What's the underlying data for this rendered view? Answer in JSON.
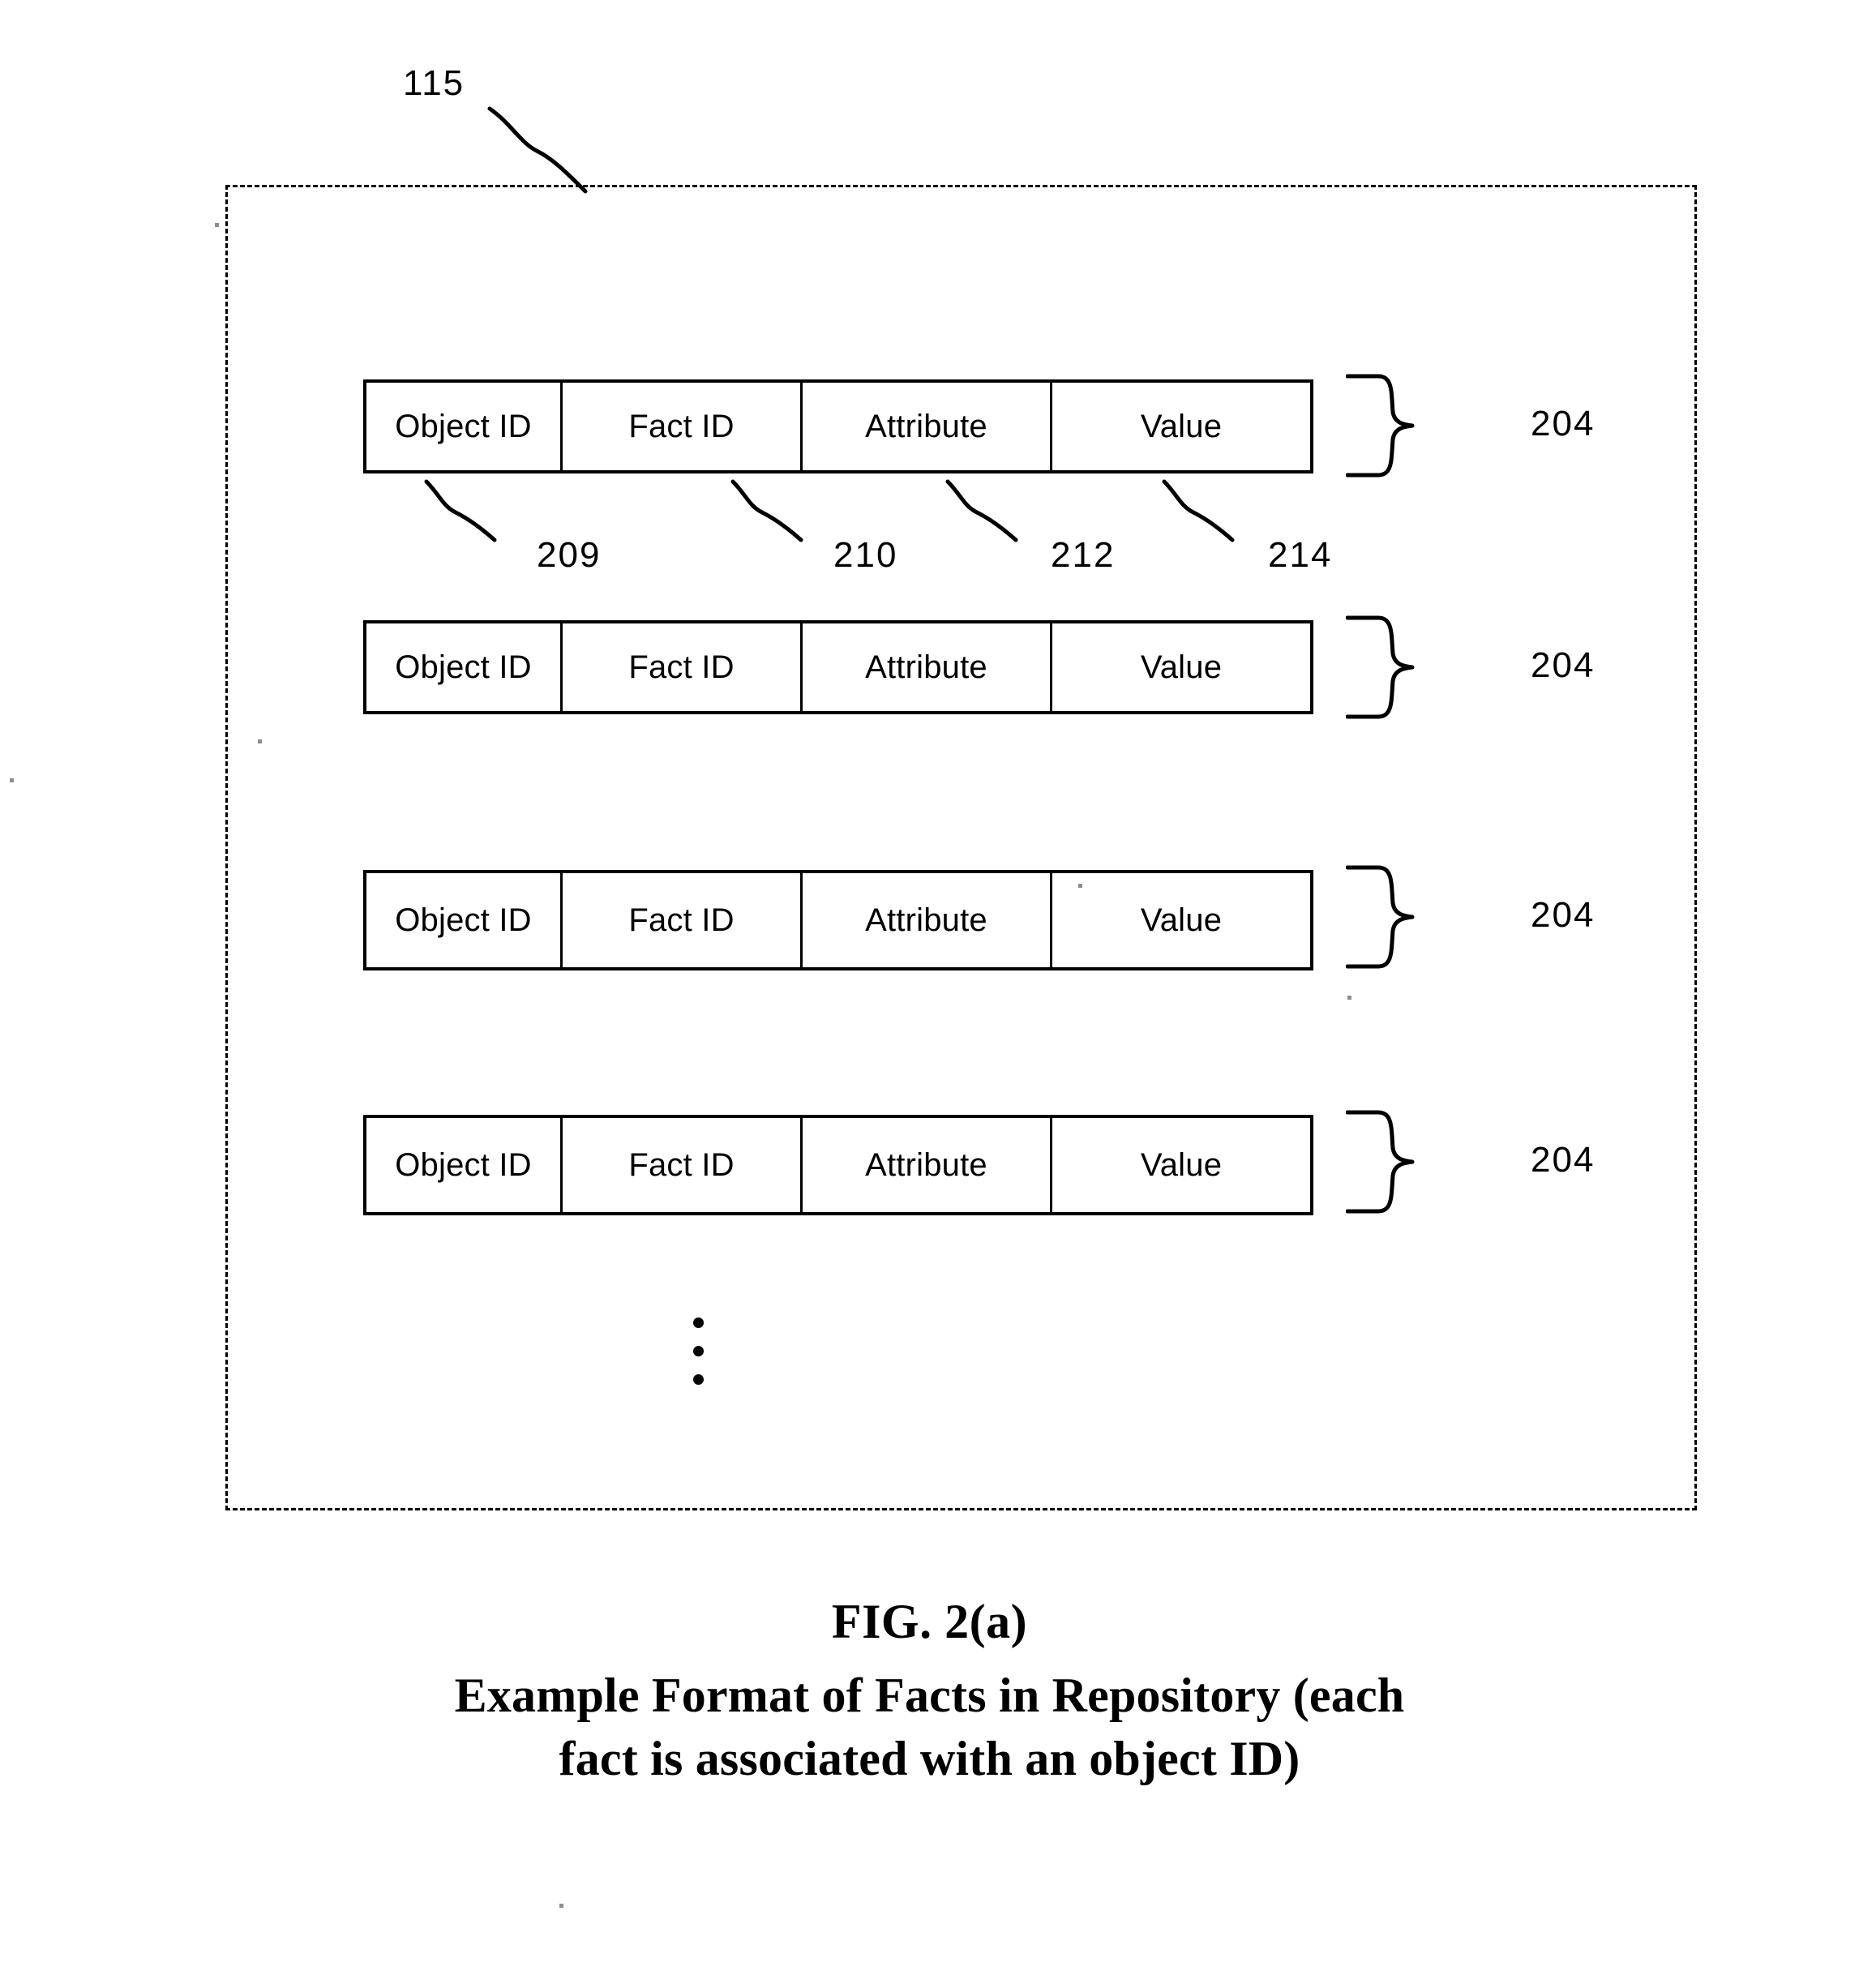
{
  "figure": {
    "container_ref": "115",
    "caption_number": "FIG. 2(a)",
    "caption_line1": "Example Format of Facts in Repository (each",
    "caption_line2": "fact is associated with an object ID)"
  },
  "columns": {
    "headers": [
      "Object ID",
      "Fact ID",
      "Attribute",
      "Value"
    ],
    "refs": [
      {
        "label": "209",
        "target": "Object ID"
      },
      {
        "label": "210",
        "target": "Fact ID"
      },
      {
        "label": "212",
        "target": "Attribute"
      },
      {
        "label": "214",
        "target": "Value"
      }
    ]
  },
  "rows": [
    {
      "ref": "204",
      "cells": {
        "object_id": "Object ID",
        "fact_id": "Fact ID",
        "attribute": "Attribute",
        "value": "Value"
      }
    },
    {
      "ref": "204",
      "cells": {
        "object_id": "Object ID",
        "fact_id": "Fact ID",
        "attribute": "Attribute",
        "value": "Value"
      }
    },
    {
      "ref": "204",
      "cells": {
        "object_id": "Object ID",
        "fact_id": "Fact ID",
        "attribute": "Attribute",
        "value": "Value"
      }
    },
    {
      "ref": "204",
      "cells": {
        "object_id": "Object ID",
        "fact_id": "Fact ID",
        "attribute": "Attribute",
        "value": "Value"
      }
    }
  ],
  "continuation": {
    "symbol": "vertical-ellipsis",
    "dot_count": 3
  },
  "colors": {
    "ink": "#000000",
    "page": "#ffffff"
  }
}
